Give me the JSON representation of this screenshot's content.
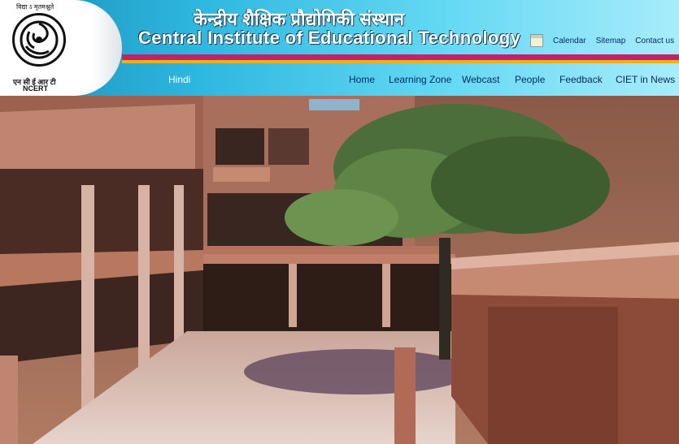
{
  "logo": {
    "tagline": "विद्या ऽ मृतमश्नुते",
    "hindi_abbr": "एन सी ई आर टी",
    "english_abbr": "NCERT"
  },
  "title": {
    "hindi": "केन्द्रीय शैक्षिक प्रौद्योगिकी संस्थान",
    "english": "Central Institute of Educational Technology"
  },
  "top_links": [
    "Calendar",
    "Sitemap",
    "Contact us"
  ],
  "nav": {
    "hindi": "Hindi",
    "items": [
      "Home",
      "Learning Zone",
      "Webcast",
      "People",
      "Feedback",
      "CIET in News"
    ]
  },
  "colors": {
    "banner": "#2fb8e0",
    "stripe_pink": "#c0226e",
    "stripe_gold": "#e8b21c",
    "nav_text": "#0b2a66"
  },
  "icons": [
    "ncert-logo",
    "calendar-icon"
  ]
}
